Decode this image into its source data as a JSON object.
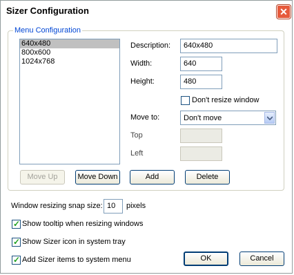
{
  "window": {
    "title": "Sizer Configuration",
    "close_glyph": "✕"
  },
  "menu_config": {
    "group_label": "Menu Configuration",
    "items": [
      "640x480",
      "800x600",
      "1024x768"
    ],
    "selected_index": 0,
    "description_label": "Description:",
    "description_value": "640x480",
    "width_label": "Width:",
    "width_value": "640",
    "height_label": "Height:",
    "height_value": "480",
    "dont_resize_label": "Don't resize window",
    "dont_resize_checked": false,
    "move_to_label": "Move to:",
    "move_to_value": "Don't move",
    "top_label": "Top",
    "top_value": "",
    "left_label": "Left",
    "left_value": "",
    "move_up_label": "Move Up",
    "move_down_label": "Move Down",
    "add_label": "Add",
    "delete_label": "Delete"
  },
  "options": {
    "snap_label": "Window resizing snap size:",
    "snap_value": "10",
    "snap_unit": "pixels",
    "tooltip_label": "Show tooltip when resizing windows",
    "tooltip_checked": true,
    "tray_label": "Show Sizer icon in system tray",
    "tray_checked": true,
    "sysmenu_label": "Add Sizer items to system menu",
    "sysmenu_checked": true
  },
  "dialog": {
    "ok_label": "OK",
    "cancel_label": "Cancel"
  },
  "colors": {
    "accent": "#0046d5",
    "close_red": "#e65a3c",
    "check_green": "#21a121"
  },
  "icons": {
    "close": "close-icon",
    "dropdown": "chevron-down-icon",
    "check": "check-icon"
  }
}
